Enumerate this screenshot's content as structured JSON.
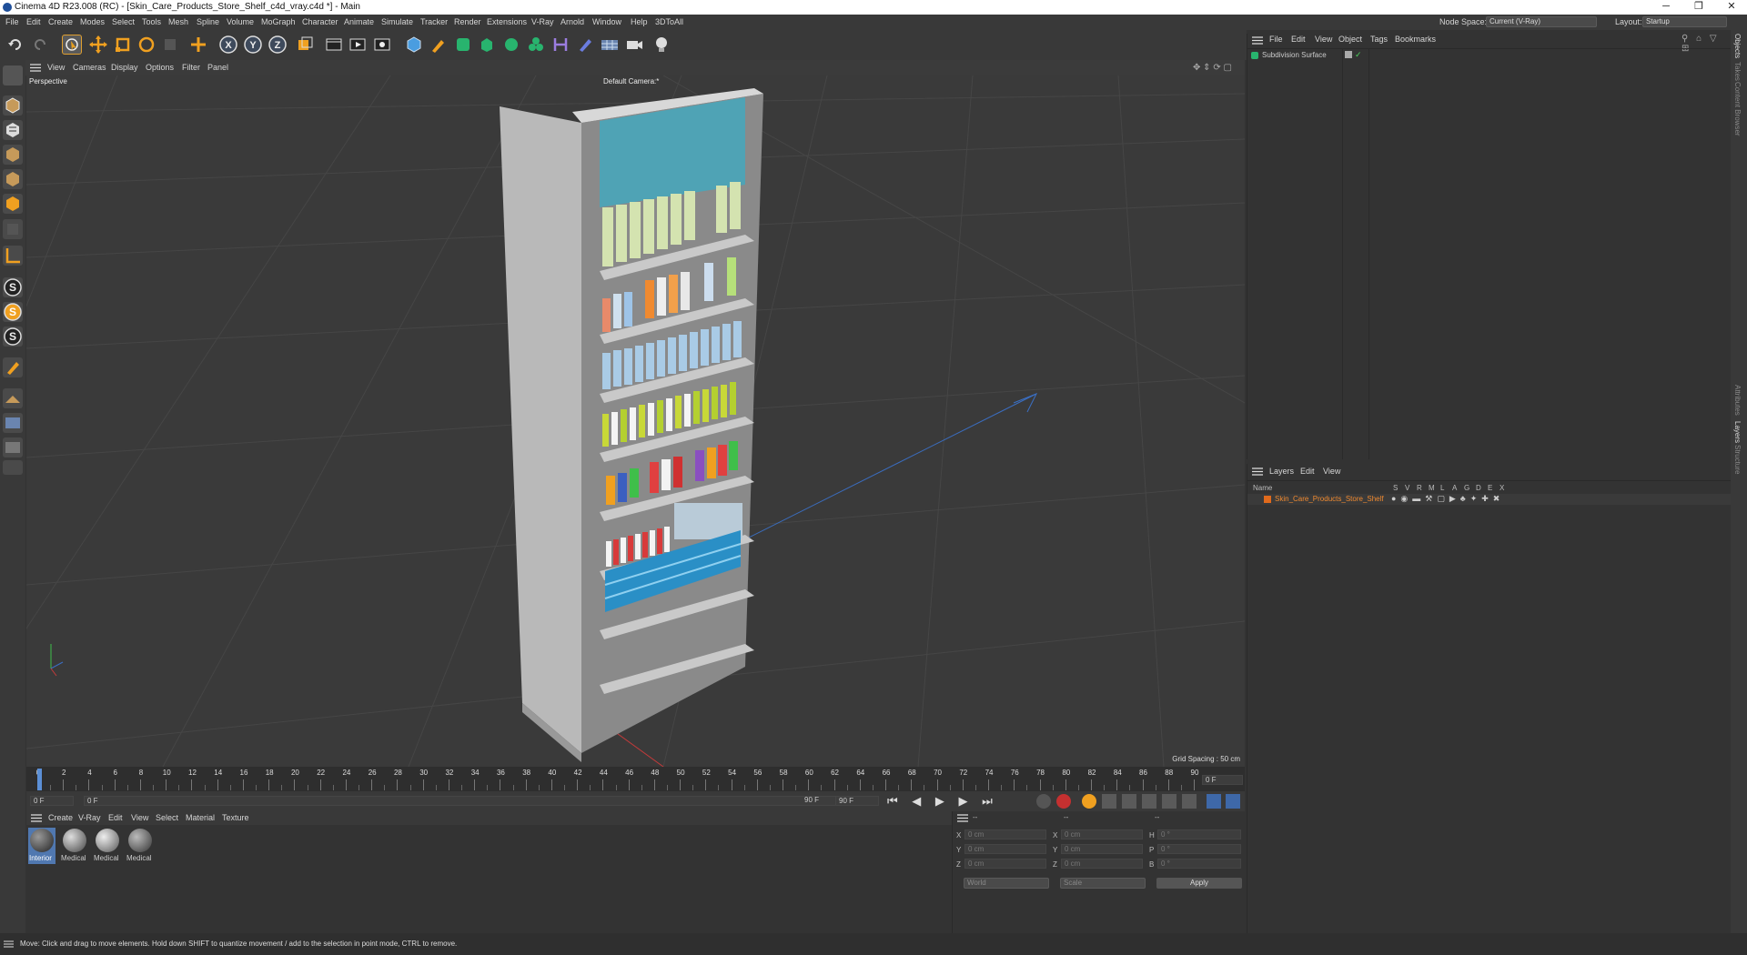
{
  "window": {
    "title": "Cinema 4D R23.008 (RC) - [Skin_Care_Products_Store_Shelf_c4d_vray.c4d *] - Main",
    "min_glyph": "─",
    "max_glyph": "❐",
    "close_glyph": "✕"
  },
  "menubar": {
    "items": [
      "File",
      "Edit",
      "Create",
      "Modes",
      "Select",
      "Tools",
      "Mesh",
      "Spline",
      "Volume",
      "MoGraph",
      "Character",
      "Animate",
      "Simulate",
      "Tracker",
      "Render",
      "Extensions",
      "V-Ray",
      "Arnold",
      "Window",
      "Help",
      "3DToAll"
    ],
    "node_space_label": "Node Space:",
    "node_space_value": "Current (V-Ray)",
    "layout_label": "Layout:",
    "layout_value": "Startup"
  },
  "toolbar": {
    "axis_labels": [
      "X",
      "Y",
      "Z"
    ],
    "icons": [
      "undo-icon",
      "redo-icon",
      "live-selection-icon",
      "move-icon",
      "scale-icon",
      "rotate-icon",
      "last-tool-icon",
      "add-tool-icon",
      "x-axis-icon",
      "y-axis-icon",
      "z-axis-icon",
      "world-coordinates-icon",
      "render-region-icon",
      "render-view-icon",
      "render-settings-icon",
      "cube-icon",
      "pen-icon",
      "subdivision-icon",
      "extrude-icon",
      "cloner-icon",
      "mograph-icon",
      "deformer-icon",
      "field-icon",
      "floor-icon",
      "camera-icon",
      "light-icon"
    ]
  },
  "left_tools": {
    "letters": [
      "S",
      "S",
      "S"
    ]
  },
  "viewport": {
    "menu": [
      "View",
      "Cameras",
      "Display",
      "Options",
      "Filter",
      "Panel"
    ],
    "view_name": "Perspective",
    "camera_name": "Default Camera",
    "camera_suffix": ":*",
    "grid_spacing": "Grid Spacing : 50 cm",
    "colors": {
      "bg": "#3a3a3a",
      "grid": "#454545",
      "shelf": "#c9c9c9",
      "header": "#4fa3b5",
      "x_axis": "#c43a3a",
      "z_axis": "#3a6fc4"
    }
  },
  "timeline": {
    "ticks": [
      "0",
      "2",
      "4",
      "6",
      "8",
      "10",
      "12",
      "14",
      "16",
      "18",
      "20",
      "22",
      "24",
      "26",
      "28",
      "30",
      "32",
      "34",
      "36",
      "38",
      "40",
      "42",
      "44",
      "46",
      "48",
      "50",
      "52",
      "54",
      "56",
      "58",
      "60",
      "62",
      "64",
      "66",
      "68",
      "70",
      "72",
      "74",
      "76",
      "78",
      "80",
      "82",
      "84",
      "86",
      "88",
      "90"
    ],
    "current_frame_right": "0 F"
  },
  "transport": {
    "start_frame": "0 F",
    "min_frame": "0 F",
    "max_frame": "90 F",
    "end_frame": "90 F"
  },
  "material_manager": {
    "menu": [
      "Create",
      "V-Ray",
      "Edit",
      "View",
      "Select",
      "Material",
      "Texture"
    ],
    "materials": [
      {
        "name": "Interior",
        "selected": true
      },
      {
        "name": "Medical",
        "selected": false
      },
      {
        "name": "Medical",
        "selected": false
      },
      {
        "name": "Medical",
        "selected": false
      }
    ]
  },
  "coordinates": {
    "header_left": "--",
    "header_mid": "--",
    "header_right": "--",
    "rows": [
      {
        "axis": "X",
        "pos": "0 cm",
        "axis2": "X",
        "size": "0 cm",
        "rot_label": "H",
        "rot": "0 °"
      },
      {
        "axis": "Y",
        "pos": "0 cm",
        "axis2": "Y",
        "size": "0 cm",
        "rot_label": "P",
        "rot": "0 °"
      },
      {
        "axis": "Z",
        "pos": "0 cm",
        "axis2": "Z",
        "size": "0 cm",
        "rot_label": "B",
        "rot": "0 °"
      }
    ],
    "mode_select": "World",
    "size_select": "Scale",
    "apply_label": "Apply"
  },
  "object_manager": {
    "menu": [
      "File",
      "Edit",
      "View",
      "Object",
      "Tags",
      "Bookmarks"
    ],
    "objects": [
      {
        "name": "Subdivision Surface"
      }
    ]
  },
  "layer_manager": {
    "menu": [
      "Layers",
      "Edit",
      "View"
    ],
    "columns": [
      "Name",
      "S",
      "V",
      "R",
      "M",
      "L",
      "A",
      "G",
      "D",
      "E",
      "X"
    ],
    "layers": [
      {
        "name": "Skin_Care_Products_Store_Shelf",
        "color": "#e06a1c"
      }
    ]
  },
  "right_tabs": [
    "Objects",
    "Takes",
    "Content Browser",
    "Attributes",
    "Layers",
    "Structure"
  ],
  "status": {
    "text": "Move: Click and drag to move elements. Hold down SHIFT to quantize movement / add to the selection in point mode, CTRL to remove."
  }
}
